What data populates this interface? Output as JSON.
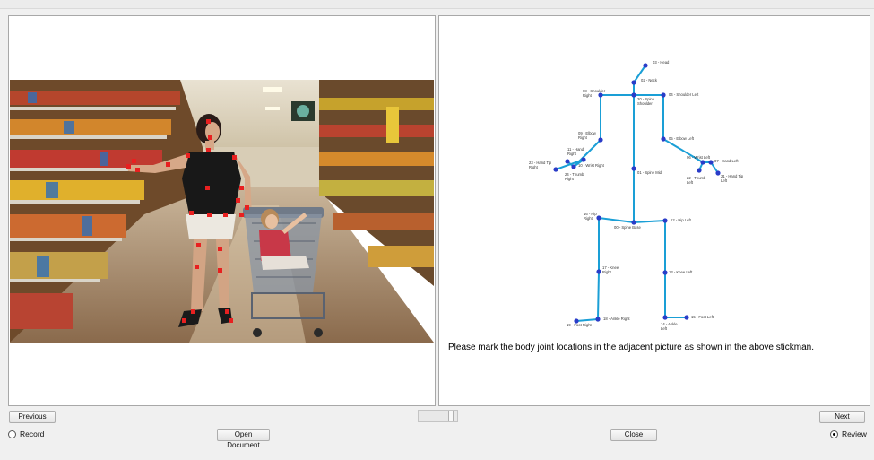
{
  "window": {
    "title": ""
  },
  "left_panel": {
    "photo_description_alt": "Woman with shopping cart and child in grocery store aisle"
  },
  "right_panel": {
    "instruction": "Please mark the body joint locations in the adjacent picture as shown in the above stickman.",
    "stickman": {
      "line_color": "#1a9fd6",
      "joint_color": "#2a3cc8",
      "joints": [
        {
          "label": "03 - Head",
          "lines": [
            "03 - Head"
          ]
        },
        {
          "label": "02 - Neck",
          "lines": [
            "02 - Neck"
          ]
        },
        {
          "label": "08 - Shoulder Right",
          "lines": [
            "08 - Shoulder",
            "Right"
          ]
        },
        {
          "label": "20 - Spine Shoulder",
          "lines": [
            "20 - Spine",
            "Shoulder"
          ]
        },
        {
          "label": "04 - Shoulder Left",
          "lines": [
            "04 - Shoulder Left"
          ]
        },
        {
          "label": "09 - Elbow Right",
          "lines": [
            "09 - Elbow",
            "Right"
          ]
        },
        {
          "label": "05 - Elbow Left",
          "lines": [
            "05 - Elbow Left"
          ]
        },
        {
          "label": "11 - Hand Right",
          "lines": [
            "11 - Hand",
            "Right"
          ]
        },
        {
          "label": "10 - Wrist Right",
          "lines": [
            "10 - Wrist Right"
          ]
        },
        {
          "label": "23 - Hand Tip Right",
          "lines": [
            "23 - Hand Tip",
            "Right"
          ]
        },
        {
          "label": "24 - Thumb Right",
          "lines": [
            "24 - Thumb",
            "Right"
          ]
        },
        {
          "label": "06 - Wrist Left",
          "lines": [
            "06 - Wrist Left"
          ]
        },
        {
          "label": "07 - Hand Left",
          "lines": [
            "07 - Hand Left"
          ]
        },
        {
          "label": "22 - Thumb Left",
          "lines": [
            "22 - Thumb",
            "Left"
          ]
        },
        {
          "label": "21 - Hand Tip Left",
          "lines": [
            "21 - Hand Tip",
            "Left"
          ]
        },
        {
          "label": "01 - Spine Mid",
          "lines": [
            "01 - Spine Mid"
          ]
        },
        {
          "label": "16 - Hip Right",
          "lines": [
            "16 - Hip",
            "Right"
          ]
        },
        {
          "label": "00 - Spine Base",
          "lines": [
            "00 - Spine Base"
          ]
        },
        {
          "label": "12 - Hip Left",
          "lines": [
            "12 - Hip Left"
          ]
        },
        {
          "label": "17 - Knee Right",
          "lines": [
            "17 - Knee",
            "Right"
          ]
        },
        {
          "label": "13 - Knee Left",
          "lines": [
            "13 - Knee Left"
          ]
        },
        {
          "label": "19 - Foot Right",
          "lines": [
            "19 - Foot Right"
          ]
        },
        {
          "label": "18 - Ankle Right",
          "lines": [
            "18 - Ankle Right"
          ]
        },
        {
          "label": "14 - Ankle Left",
          "lines": [
            "14 - Ankle",
            "Left"
          ]
        },
        {
          "label": "15 - Foot Left",
          "lines": [
            "15 - Foot Left"
          ]
        }
      ]
    }
  },
  "controls": {
    "previous_label": "Previous",
    "next_label": "Next",
    "open_document_label": "Open Document",
    "close_label": "Close",
    "record_label": "Record",
    "review_label": "Review",
    "record_checked": false,
    "review_checked": true
  }
}
